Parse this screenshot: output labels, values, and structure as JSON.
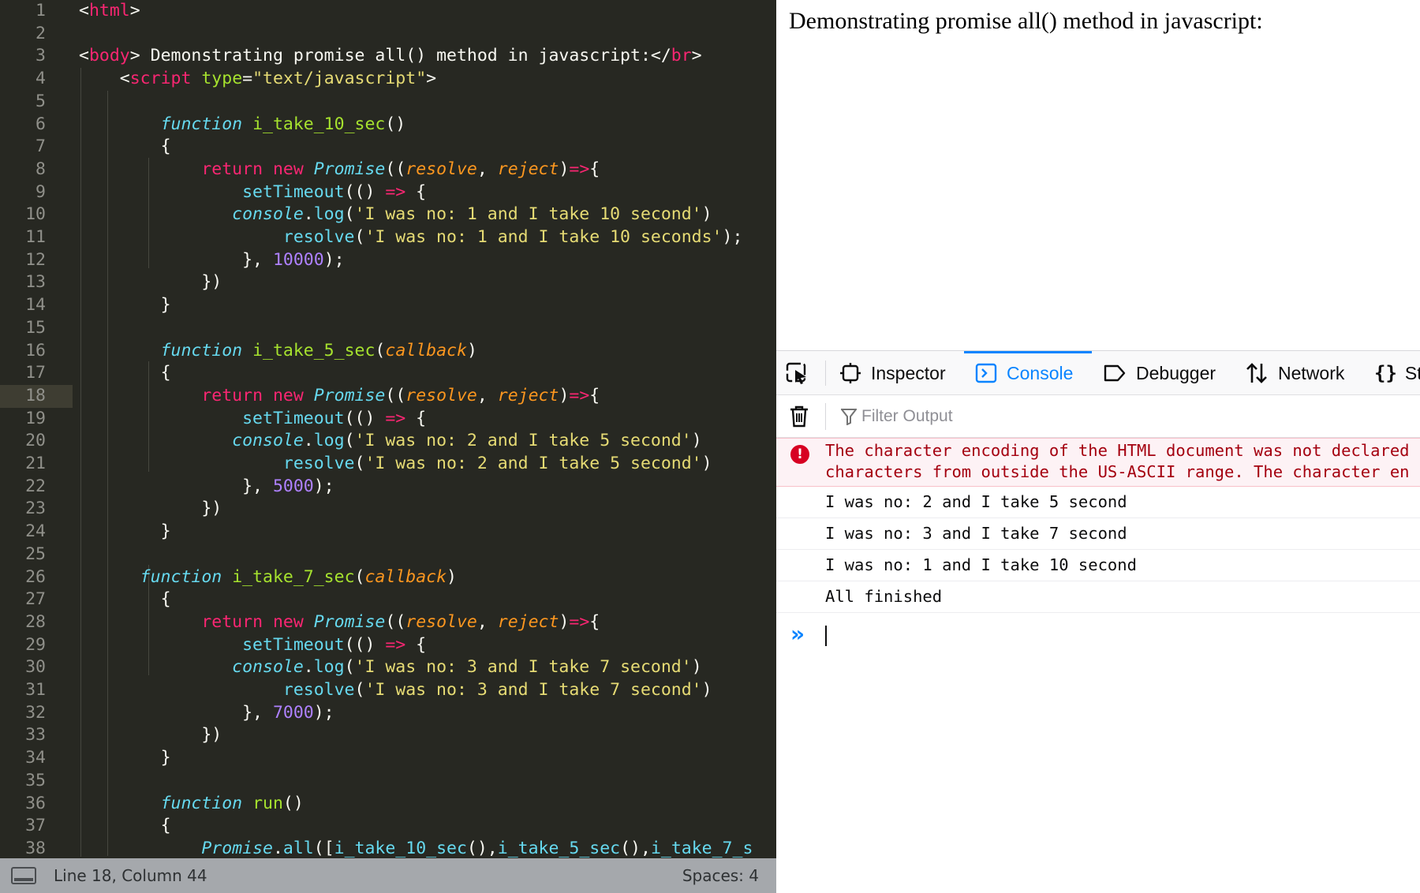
{
  "editor": {
    "line_numbers": [
      "1",
      "2",
      "3",
      "4",
      "5",
      "6",
      "7",
      "8",
      "9",
      "10",
      "11",
      "12",
      "13",
      "14",
      "15",
      "16",
      "17",
      "18",
      "19",
      "20",
      "21",
      "22",
      "23",
      "24",
      "25",
      "26",
      "27",
      "28",
      "29",
      "30",
      "31",
      "32",
      "33",
      "34",
      "35",
      "36",
      "37",
      "38"
    ],
    "tokens": {
      "html_open": "html",
      "body_tag": "body",
      "body_text": " Demonstrating promise all() method in javascript:</",
      "br_tag": "br",
      "script_tag": "script",
      "type_attr": "type",
      "type_value": "\"text/javascript\"",
      "function_kw": "function",
      "fn1_name": "i_take_10_sec",
      "fn2_name": "i_take_5_sec",
      "fn3_name": "i_take_7_sec",
      "fn4_name": "run",
      "callback_param": "callback",
      "return_kw": "return",
      "new_kw": "new",
      "promise_class": "Promise",
      "resolve_param": "resolve",
      "reject_param": "reject",
      "arrow": "=>",
      "settimeout": "setTimeout",
      "console_obj": "console",
      "log_fn": "log",
      "resolve_call": "resolve",
      "str1_log": "'I was no: 1 and I take 10 second'",
      "str1_resolve": "'I was no: 1 and I take 10 seconds'",
      "num1": "10000",
      "str2_log": "'I was no: 2 and I take 5 second'",
      "str2_resolve": "'I was no: 2 and I take 5 second'",
      "num2": "5000",
      "str3_log": "'I was no: 3 and I take 7 second'",
      "str3_resolve": "'I was no: 3 and I take 7 second'",
      "num3": "7000",
      "all_fn": "all",
      "call_10": "i_take_10_sec",
      "call_5": "i_take_5_sec",
      "call_7": "i_take_7_s"
    }
  },
  "statusbar": {
    "position": "Line 18, Column 44",
    "indent": "Spaces: 4"
  },
  "browser": {
    "page_text": "Demonstrating promise all() method in javascript:"
  },
  "devtools": {
    "tabs": [
      {
        "label": "Inspector"
      },
      {
        "label": "Console"
      },
      {
        "label": "Debugger"
      },
      {
        "label": "Network"
      },
      {
        "label": "St"
      }
    ],
    "filter_placeholder": "Filter Output",
    "error": {
      "line1": "The character encoding of the HTML document was not declared",
      "line2": "characters from outside the US-ASCII range. The character en"
    },
    "logs": [
      "I was no: 2 and I take 5 second",
      "I was no: 3 and I take 7 second",
      "I was no: 1 and I take 10 second",
      "All finished"
    ],
    "prompt_symbol": "»"
  }
}
